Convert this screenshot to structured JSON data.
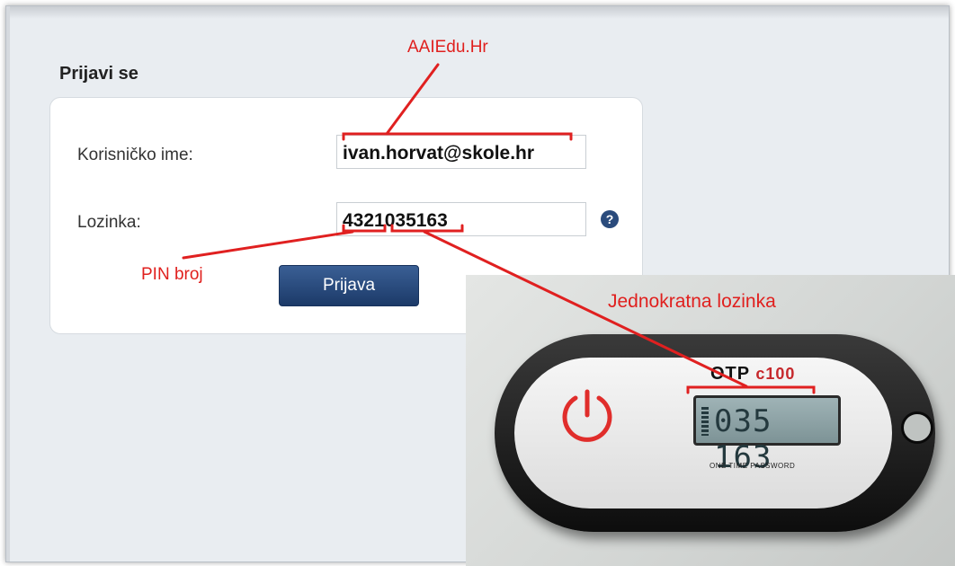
{
  "login": {
    "title": "Prijavi se",
    "username_label": "Korisničko ime:",
    "username_value": "ivan.horvat@skole.hr",
    "password_label": "Lozinka:",
    "password_value": "4321035163",
    "help_icon": "question-icon",
    "submit_label": "Prijava"
  },
  "annotations": {
    "domain_label": "AAIEdu.Hr",
    "pin_label": "PIN broj",
    "otp_label": "Jednokratna lozinka"
  },
  "token": {
    "brand": "OTP",
    "model": "c100",
    "display": "035 163",
    "caption": "ONE TIME PASSWORD",
    "icon": "power-icon"
  },
  "colors": {
    "annotation": "#e0201e",
    "button": "#1f3d6e",
    "background": "#e9edf1"
  }
}
